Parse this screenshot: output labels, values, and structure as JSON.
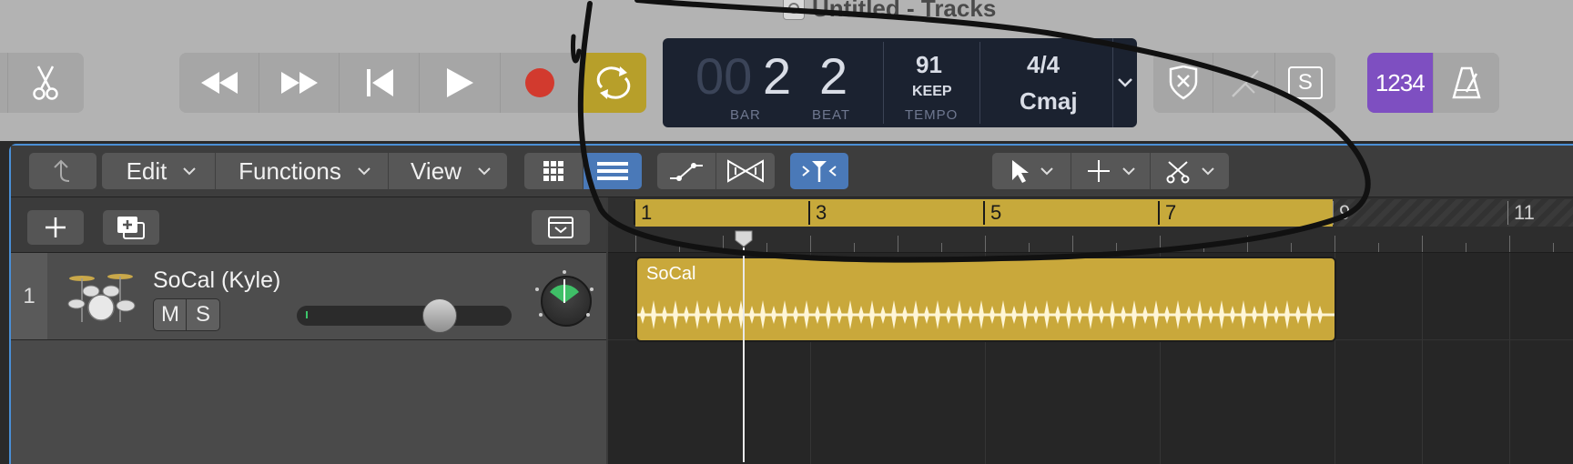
{
  "window": {
    "title": "Untitled - Tracks"
  },
  "transport": {
    "rewind_label": "Rewind",
    "forward_label": "Fast Forward",
    "to_start_label": "Go to Beginning",
    "play_label": "Play",
    "record_label": "Record",
    "cycle_label": "Cycle"
  },
  "lcd": {
    "bar_prefix": "00",
    "bar_value": "2",
    "bar_label": "BAR",
    "beat_value": "2",
    "beat_label": "BEAT",
    "tempo_value": "91",
    "tempo_mode": "KEEP",
    "tempo_label": "TEMPO",
    "time_signature": "4/4",
    "key": "Cmaj"
  },
  "right_controls": {
    "solo_label": "S",
    "count_in_label": "1234"
  },
  "toolbar": {
    "edit_label": "Edit",
    "functions_label": "Functions",
    "view_label": "View"
  },
  "ruler": {
    "bars": [
      "1",
      "3",
      "5",
      "7",
      "9",
      "11"
    ]
  },
  "track": {
    "number": "1",
    "name": "SoCal (Kyle)",
    "mute_label": "M",
    "solo_label": "S",
    "volume_level": 0.66
  },
  "region": {
    "name": "SoCal"
  },
  "colors": {
    "cycle": "#c7a93b",
    "region": "#c9a83b",
    "count_in": "#7e4fc1",
    "record": "#d23a2e",
    "accent_blue": "#4a79b8"
  }
}
